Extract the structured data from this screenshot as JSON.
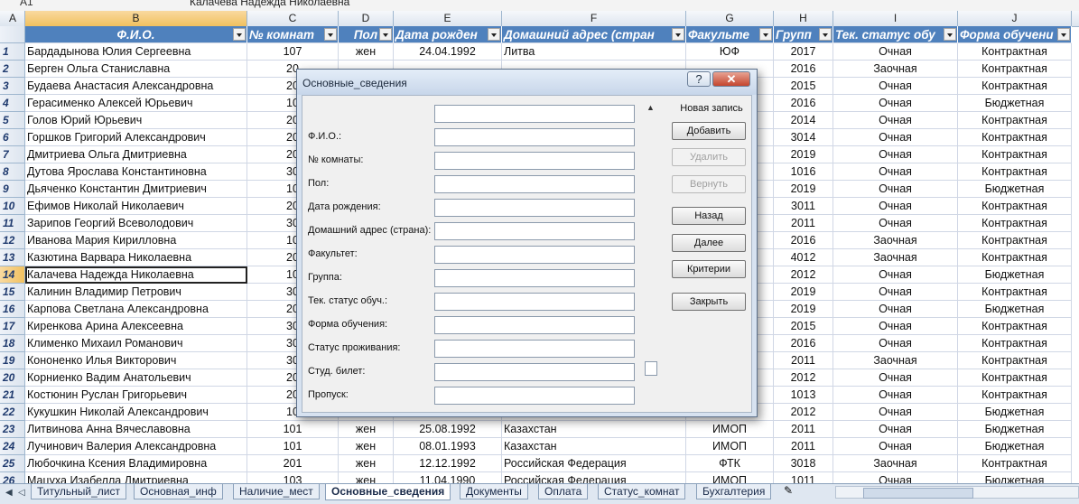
{
  "name_box": "A1",
  "formula": "Калачева Надежда Николаевна",
  "columns": [
    "A",
    "B",
    "C",
    "D",
    "E",
    "F",
    "G",
    "H",
    "I",
    "J"
  ],
  "headers": [
    "Ф.И.О.",
    "№ комнат",
    "Пол",
    "Дата рожден",
    "Домашний адрес (стран",
    "Факульте",
    "Групп",
    "Тек. статус обу",
    "Форма обучени"
  ],
  "rows": [
    {
      "n": "1",
      "fio": "Бардадынова Юлия Сергеевна",
      "room": "107",
      "sex": "жен",
      "dob": "24.04.1992",
      "addr": "Литва",
      "fac": "ЮФ",
      "grp": "2017",
      "status": "Очная",
      "form": "Контрактная"
    },
    {
      "n": "2",
      "fio": "Берген Ольга Станиславна",
      "room": "20",
      "sex": "",
      "dob": "",
      "addr": "",
      "fac": "",
      "grp": "2016",
      "status": "Заочная",
      "form": "Контрактная"
    },
    {
      "n": "3",
      "fio": "Будаева Анастасия Александровна",
      "room": "20",
      "sex": "",
      "dob": "",
      "addr": "",
      "fac": "",
      "grp": "2015",
      "status": "Очная",
      "form": "Контрактная"
    },
    {
      "n": "4",
      "fio": "Герасименко Алексей Юрьевич",
      "room": "10",
      "sex": "",
      "dob": "",
      "addr": "",
      "fac": "",
      "grp": "2016",
      "status": "Очная",
      "form": "Бюджетная"
    },
    {
      "n": "5",
      "fio": "Голов Юрий Юрьевич",
      "room": "20",
      "sex": "",
      "dob": "",
      "addr": "",
      "fac": "",
      "grp": "2014",
      "status": "Очная",
      "form": "Контрактная"
    },
    {
      "n": "6",
      "fio": "Горшков Григорий Александрович",
      "room": "20",
      "sex": "",
      "dob": "",
      "addr": "",
      "fac": "",
      "grp": "3014",
      "status": "Очная",
      "form": "Контрактная"
    },
    {
      "n": "7",
      "fio": "Дмитриева Ольга Дмитриевна",
      "room": "20",
      "sex": "",
      "dob": "",
      "addr": "",
      "fac": "",
      "grp": "2019",
      "status": "Очная",
      "form": "Контрактная"
    },
    {
      "n": "8",
      "fio": "Дутова Ярослава Константиновна",
      "room": "30",
      "sex": "",
      "dob": "",
      "addr": "",
      "fac": "",
      "grp": "1016",
      "status": "Очная",
      "form": "Контрактная"
    },
    {
      "n": "9",
      "fio": "Дьяченко Константин Дмитриевич",
      "room": "10",
      "sex": "",
      "dob": "",
      "addr": "",
      "fac": "",
      "grp": "2019",
      "status": "Очная",
      "form": "Бюджетная"
    },
    {
      "n": "10",
      "fio": "Ефимов Николай Николаевич",
      "room": "20",
      "sex": "",
      "dob": "",
      "addr": "",
      "fac": "",
      "grp": "3011",
      "status": "Очная",
      "form": "Контрактная"
    },
    {
      "n": "11",
      "fio": "Зарипов Георгий Всеволодович",
      "room": "30",
      "sex": "",
      "dob": "",
      "addr": "",
      "fac": "",
      "grp": "2011",
      "status": "Очная",
      "form": "Контрактная"
    },
    {
      "n": "12",
      "fio": "Иванова Мария Кирилловна",
      "room": "10",
      "sex": "",
      "dob": "",
      "addr": "",
      "fac": "",
      "grp": "2016",
      "status": "Заочная",
      "form": "Контрактная"
    },
    {
      "n": "13",
      "fio": "Казютина Варвара Николаевна",
      "room": "20",
      "sex": "",
      "dob": "",
      "addr": "",
      "fac": "",
      "grp": "4012",
      "status": "Заочная",
      "form": "Контрактная"
    },
    {
      "n": "14",
      "fio": "Калачева Надежда Николаевна",
      "room": "10",
      "sex": "",
      "dob": "",
      "addr": "",
      "fac": "",
      "grp": "2012",
      "status": "Очная",
      "form": "Бюджетная"
    },
    {
      "n": "15",
      "fio": "Калинин Владимир Петрович",
      "room": "30",
      "sex": "",
      "dob": "",
      "addr": "",
      "fac": "",
      "grp": "2019",
      "status": "Очная",
      "form": "Контрактная"
    },
    {
      "n": "16",
      "fio": "Карпова Светлана Александровна",
      "room": "20",
      "sex": "",
      "dob": "",
      "addr": "",
      "fac": "",
      "grp": "2019",
      "status": "Очная",
      "form": "Бюджетная"
    },
    {
      "n": "17",
      "fio": "Киренкова Арина Алексеевна",
      "room": "30",
      "sex": "",
      "dob": "",
      "addr": "",
      "fac": "",
      "grp": "2015",
      "status": "Очная",
      "form": "Контрактная"
    },
    {
      "n": "18",
      "fio": "Клименко Михаил Романович",
      "room": "30",
      "sex": "",
      "dob": "",
      "addr": "",
      "fac": "",
      "grp": "2016",
      "status": "Очная",
      "form": "Контрактная"
    },
    {
      "n": "19",
      "fio": "Кононенко Илья Викторович",
      "room": "30",
      "sex": "",
      "dob": "",
      "addr": "",
      "fac": "",
      "grp": "2011",
      "status": "Заочная",
      "form": "Контрактная"
    },
    {
      "n": "20",
      "fio": "Корниенко Вадим Анатольевич",
      "room": "20",
      "sex": "",
      "dob": "",
      "addr": "",
      "fac": "",
      "grp": "2012",
      "status": "Очная",
      "form": "Контрактная"
    },
    {
      "n": "21",
      "fio": "Костюнин Руслан Григорьевич",
      "room": "20",
      "sex": "",
      "dob": "",
      "addr": "",
      "fac": "",
      "grp": "1013",
      "status": "Очная",
      "form": "Контрактная"
    },
    {
      "n": "22",
      "fio": "Кукушкин Николай Александрович",
      "room": "10",
      "sex": "",
      "dob": "",
      "addr": "",
      "fac": "",
      "grp": "2012",
      "status": "Очная",
      "form": "Бюджетная"
    },
    {
      "n": "23",
      "fio": "Литвинова Анна Вячеславовна",
      "room": "101",
      "sex": "жен",
      "dob": "25.08.1992",
      "addr": "Казахстан",
      "fac": "ИМОП",
      "grp": "2011",
      "status": "Очная",
      "form": "Бюджетная"
    },
    {
      "n": "24",
      "fio": "Лучинович Валерия Александровна",
      "room": "101",
      "sex": "жен",
      "dob": "08.01.1993",
      "addr": "Казахстан",
      "fac": "ИМОП",
      "grp": "2011",
      "status": "Очная",
      "form": "Бюджетная"
    },
    {
      "n": "25",
      "fio": "Любочкина Ксения Владимировна",
      "room": "201",
      "sex": "жен",
      "dob": "12.12.1992",
      "addr": "Российская Федерация",
      "fac": "ФТК",
      "grp": "3018",
      "status": "Заочная",
      "form": "Контрактная"
    },
    {
      "n": "26",
      "fio": "Мацуха Изабелла Дмитриевна",
      "room": "103",
      "sex": "жен",
      "dob": "11.04.1990",
      "addr": "Российская Федерация",
      "fac": "ИМОП",
      "grp": "1011",
      "status": "Очная",
      "form": "Бюджетная"
    }
  ],
  "dialog": {
    "title": "Основные_сведения",
    "help": "?",
    "close": "✕",
    "new_record": "Новая запись",
    "fields": [
      "Ф.И.О.:",
      "№ комнаты:",
      "Пол:",
      "Дата рождения:",
      "Домашний адрес (страна):",
      "Факультет:",
      "Группа:",
      "Тек. статус обуч.:",
      "Форма обучения:",
      "Статус проживания:",
      "Студ. билет:",
      "Пропуск:"
    ],
    "buttons": {
      "add": "Добавить",
      "delete": "Удалить",
      "restore": "Вернуть",
      "back": "Назад",
      "next": "Далее",
      "criteria": "Критерии",
      "close": "Закрыть"
    }
  },
  "tabs": [
    "Титульный_лист",
    "Основная_инф",
    "Наличие_мест",
    "Основные_сведения",
    "Документы",
    "Оплата",
    "Статус_комнат",
    "Бухгалтерия"
  ],
  "active_tab": "Основные_сведения"
}
